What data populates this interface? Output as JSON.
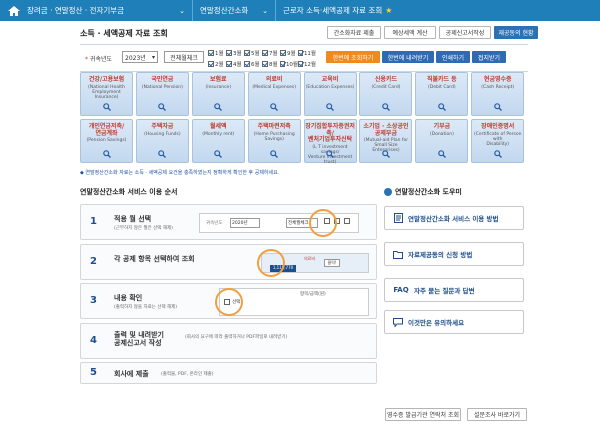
{
  "nav": {
    "crumbs": [
      "장려금 · 연말정산 · 전자기부금",
      "연말정산간소화",
      "근로자 소득·세액공제 자료 조회"
    ]
  },
  "page": {
    "title": "소득 · 세액공제 자료 조회",
    "top_buttons": [
      "간소화자료 제출",
      "예상세액 계산",
      "공제신고서작성",
      "재공동의 현황"
    ]
  },
  "filter": {
    "label": "귀속년도",
    "required_mark": "*",
    "year": "2023년",
    "all_button": "전체월체크",
    "months": [
      {
        "label": "1월",
        "checked": true
      },
      {
        "label": "3월",
        "checked": true
      },
      {
        "label": "5월",
        "checked": true
      },
      {
        "label": "7월",
        "checked": true
      },
      {
        "label": "9월",
        "checked": true
      },
      {
        "label": "11월",
        "checked": true
      },
      {
        "label": "2월",
        "checked": true
      },
      {
        "label": "4월",
        "checked": true
      },
      {
        "label": "6월",
        "checked": true
      },
      {
        "label": "8월",
        "checked": true
      },
      {
        "label": "10월",
        "checked": true
      },
      {
        "label": "12월",
        "checked": true
      }
    ],
    "buttons": [
      "한번에 조회하기",
      "한번에 내려받기",
      "인쇄하기",
      "접지받기"
    ]
  },
  "tiles": [
    {
      "name": "건강/고용보험",
      "en": "(National Health\nEmployment Insurance)"
    },
    {
      "name": "국민연금",
      "en": "(National Pension)"
    },
    {
      "name": "보험료",
      "en": "(Insurance)"
    },
    {
      "name": "의료비",
      "en": "(Medical Expenses)"
    },
    {
      "name": "교육비",
      "en": "(Education Expenses)"
    },
    {
      "name": "신용카드",
      "en": "(Credit Card)"
    },
    {
      "name": "직불카드 등",
      "en": "(Debit Card)"
    },
    {
      "name": "현금영수증",
      "en": "(Cash Receipt)"
    },
    {
      "name": "개인연금저축/\n연금계좌",
      "en": "(Pension Savings)"
    },
    {
      "name": "주택자금",
      "en": "(Housing Funds)"
    },
    {
      "name": "월세액",
      "en": "(Monthly rent)"
    },
    {
      "name": "주택마련저축",
      "en": "(Home Purchasing Savings)"
    },
    {
      "name": "장기집합투자증권저축/\n벤처기업투자신탁",
      "en": "(L T investment savings/\nVenture investment trust)"
    },
    {
      "name": "소기업 · 소상공인\n공제부금",
      "en": "(Mutual-aid Plan for\nSmall Size Enterprises)"
    },
    {
      "name": "기부금",
      "en": "(Donation)"
    },
    {
      "name": "장애인증명서",
      "en": "(Certificate of Person with\nDisability)"
    }
  ],
  "notice": "◆ 연말정산간소화 자료는 소득 · 세액공제 요건을 충족하였는지 정확하게 확인한 후 공제하세요.",
  "guide": {
    "title": "연말정산간소화 서비스 이용 순서",
    "steps": [
      {
        "num": "1",
        "title": "적용 월 선택",
        "sub": "(근무하지 않은 월은 선택 해제)"
      },
      {
        "num": "2",
        "title": "각 공제 항목 선택하여 조회",
        "sub": ""
      },
      {
        "num": "3",
        "title": "내용 확인",
        "sub": "(출력하지 않을 자료는 선택 해제)"
      },
      {
        "num": "4",
        "title": "출력 및 내려받기\n공제신고서 작성",
        "sub": "(회사의 요구에 따라 출력하거나 PDF파일로 내려받기)"
      },
      {
        "num": "5",
        "title": "회사에 제출",
        "sub": "(출력물, PDF, 온라인 제출)"
      }
    ],
    "mock": {
      "year_label": "귀속년도",
      "year": "2020년",
      "all_check": "전체월체크",
      "tile_label": "의료비",
      "click_label": "클릭!",
      "amount": "1,115,770",
      "cb_col": "선택",
      "col_header": "항목/금액(원)"
    }
  },
  "help": {
    "title": "연말정산간소화 도우미",
    "items": [
      "연말정산간소화 서비스 이용 방법",
      "자료제공동의 신청 방법",
      "자주 묻는 질문과 답변",
      "이것만은 유의하세요"
    ],
    "faq_prefix": "FAQ"
  },
  "bottom_buttons": [
    "영수증 발급기관 연락처 조회",
    "설문조사 바로가기"
  ]
}
